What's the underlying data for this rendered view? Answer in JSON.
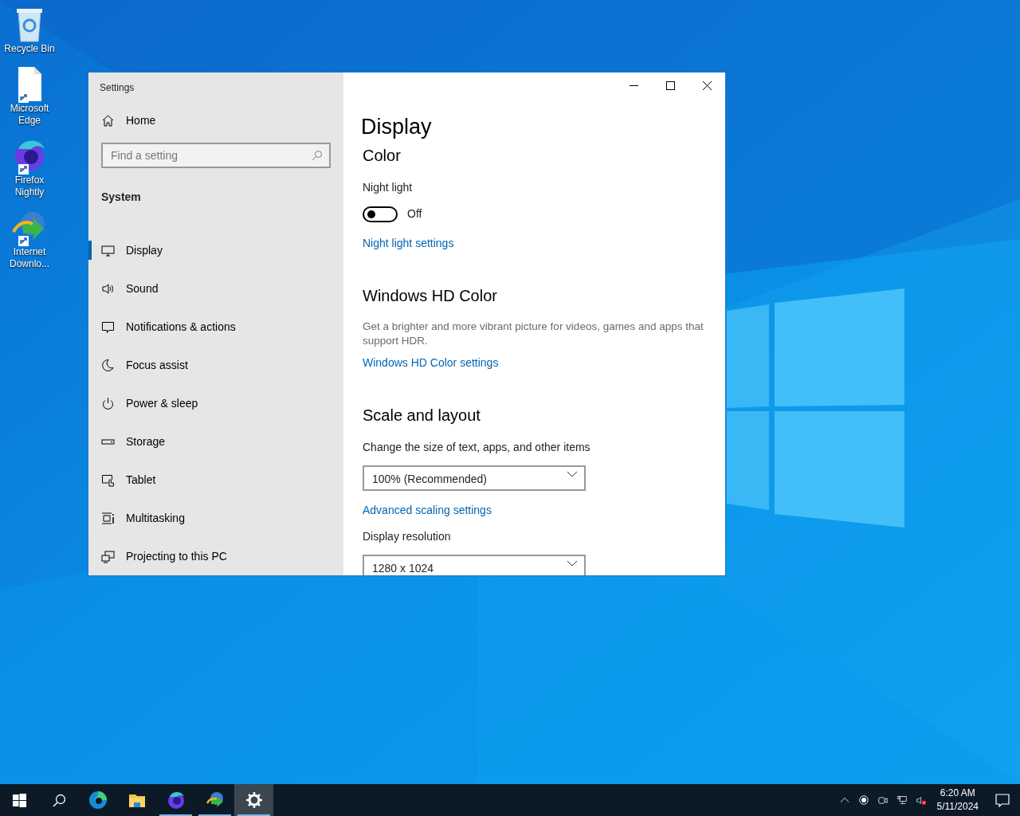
{
  "desktop_icons": [
    {
      "label": "Recycle Bin",
      "kind": "recycle",
      "shortcut": false
    },
    {
      "label": "Microsoft Edge",
      "kind": "file",
      "shortcut": true
    },
    {
      "label": "Firefox Nightly",
      "kind": "firefox",
      "shortcut": true
    },
    {
      "label": "Internet Downlo...",
      "kind": "idm",
      "shortcut": true
    }
  ],
  "window": {
    "title": "Settings",
    "sidebar": {
      "home": "Home",
      "search": {
        "placeholder": "Find a setting"
      },
      "section": "System",
      "items": [
        {
          "label": "Display",
          "kind": "display",
          "selected": true
        },
        {
          "label": "Sound",
          "kind": "sound",
          "selected": false
        },
        {
          "label": "Notifications & actions",
          "kind": "notifications",
          "selected": false
        },
        {
          "label": "Focus assist",
          "kind": "moon",
          "selected": false
        },
        {
          "label": "Power & sleep",
          "kind": "power",
          "selected": false
        },
        {
          "label": "Storage",
          "kind": "storage",
          "selected": false
        },
        {
          "label": "Tablet",
          "kind": "tablet",
          "selected": false
        },
        {
          "label": "Multitasking",
          "kind": "multitasking",
          "selected": false
        },
        {
          "label": "Projecting to this PC",
          "kind": "projecting",
          "selected": false
        }
      ]
    },
    "content": {
      "title": "Display",
      "sections": [
        {
          "heading": "Color",
          "items": [
            {
              "kind": "label",
              "text": "Night light"
            },
            {
              "kind": "toggle",
              "on": false,
              "text": "Off"
            },
            {
              "kind": "link",
              "text": "Night light settings"
            }
          ]
        },
        {
          "heading": "Windows HD Color",
          "items": [
            {
              "kind": "description",
              "text": "Get a brighter and more vibrant picture for videos, games and apps that support HDR."
            },
            {
              "kind": "link",
              "text": "Windows HD Color settings"
            }
          ]
        },
        {
          "heading": "Scale and layout",
          "items": [
            {
              "kind": "label",
              "text": "Change the size of text, apps, and other items"
            },
            {
              "kind": "dropdown",
              "value": "100% (Recommended)"
            },
            {
              "kind": "link",
              "text": "Advanced scaling settings"
            },
            {
              "kind": "label",
              "text": "Display resolution"
            },
            {
              "kind": "dropdown",
              "value": "1280 x 1024"
            }
          ]
        }
      ]
    }
  },
  "taskbar": {
    "apps": [
      {
        "kind": "start",
        "running": false,
        "selected": false
      },
      {
        "kind": "search",
        "running": false,
        "selected": false
      },
      {
        "kind": "edge",
        "running": false,
        "selected": false
      },
      {
        "kind": "explorer",
        "running": false,
        "selected": false
      },
      {
        "kind": "firefox",
        "running": true,
        "selected": false
      },
      {
        "kind": "idm",
        "running": true,
        "selected": false
      },
      {
        "kind": "settings",
        "running": true,
        "selected": true
      }
    ],
    "tray": [
      {
        "kind": "chevron"
      },
      {
        "kind": "record"
      },
      {
        "kind": "camera"
      },
      {
        "kind": "network"
      },
      {
        "kind": "muted"
      }
    ],
    "time": "6:20 AM",
    "date": "5/11/2024"
  }
}
